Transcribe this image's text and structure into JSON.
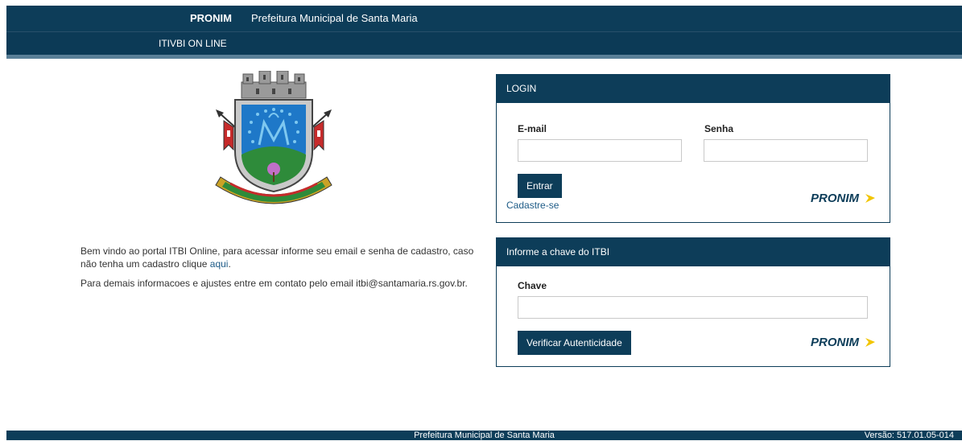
{
  "header": {
    "brand": "PRONIM",
    "organization": "Prefeitura Municipal de Santa Maria",
    "nav_item": "ITIVBI ON LINE"
  },
  "intro": {
    "line1_text": "Bem vindo ao portal ITBI Online, para acessar informe seu email e senha de cadastro, caso não tenha um cadastro clique ",
    "line1_link": "aqui",
    "line1_end": ".",
    "line2": "Para demais informacoes e ajustes entre em contato pelo email itbi@santamaria.rs.gov.br."
  },
  "login_panel": {
    "title": "LOGIN",
    "email_label": "E-mail",
    "email_value": "",
    "password_label": "Senha",
    "password_value": "",
    "submit_label": "Entrar",
    "register_link": "Cadastre-se",
    "logo_text": "PRONIM"
  },
  "chave_panel": {
    "title": "Informe a chave do ITBI",
    "key_label": "Chave",
    "key_value": "",
    "verify_label": "Verificar Autenticidade",
    "logo_text": "PRONIM"
  },
  "footer": {
    "center": "Prefeitura Municipal de Santa Maria",
    "version": "Versão: 517.01.05-014"
  },
  "colors": {
    "primary": "#0d3d59",
    "accent": "#f2c500",
    "link": "#1c5a86"
  },
  "icons": [
    "municipal-crest-icon",
    "pronim-logo-icon"
  ]
}
